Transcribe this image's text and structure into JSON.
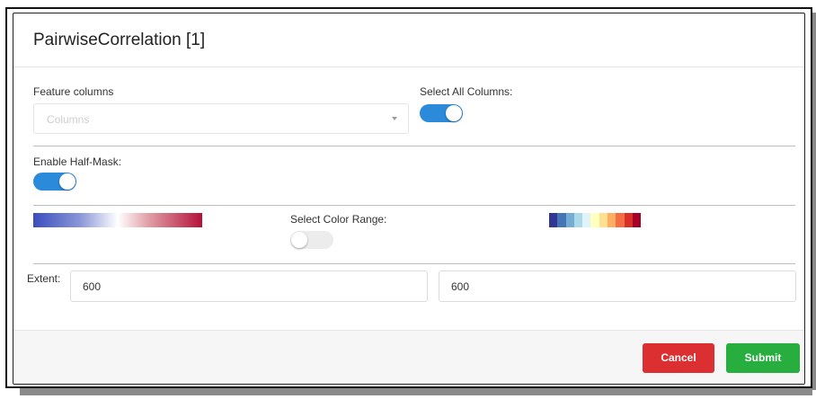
{
  "modal": {
    "title": "PairwiseCorrelation [1]"
  },
  "feature_columns": {
    "label": "Feature columns",
    "placeholder": "Columns"
  },
  "select_all_columns": {
    "label": "Select All Columns:",
    "enabled": true
  },
  "half_mask": {
    "label": "Enable Half-Mask:",
    "enabled": true
  },
  "color_range": {
    "label": "Select Color Range:",
    "enabled": false,
    "left_gradient_colors": [
      "#3a4dbe",
      "#8b97d8",
      "#ffffff",
      "#e0a0a8",
      "#b4103a"
    ],
    "right_palette_colors": [
      "#313695",
      "#4575b4",
      "#74add1",
      "#abd9e9",
      "#e0f3f8",
      "#ffffbf",
      "#fee090",
      "#fdae61",
      "#f46d43",
      "#d73027",
      "#a50026"
    ]
  },
  "extent": {
    "label": "Extent:",
    "value_1": "600",
    "value_2": "600"
  },
  "footer": {
    "cancel_label": "Cancel",
    "submit_label": "Submit"
  },
  "colors": {
    "toggle_on": "#2b8ad9",
    "cancel": "#dc2f32",
    "submit": "#27ae3f"
  }
}
